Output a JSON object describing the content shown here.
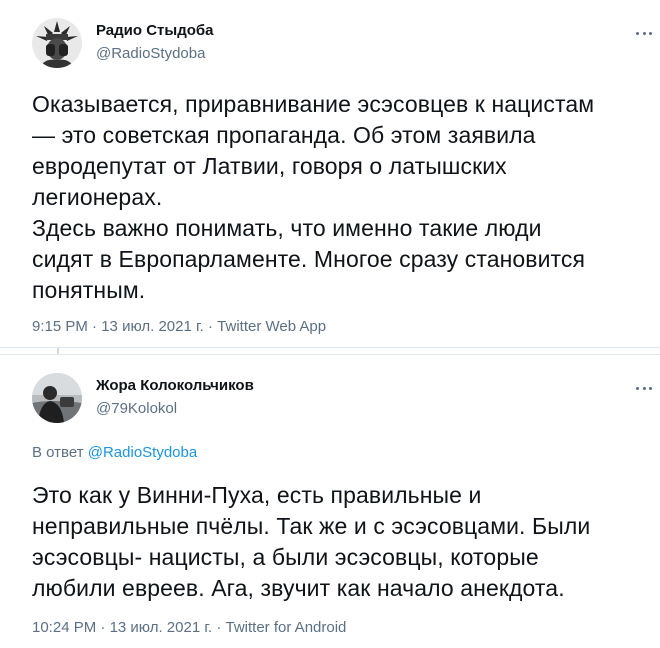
{
  "tweets": [
    {
      "author": {
        "name": "Радио Стыдоба",
        "handle": "@RadioStydoba",
        "avatar_icon": "statue-avatar"
      },
      "more_icon": "more-options-icon",
      "lines": [
        "Оказывается, приравнивание эсэсовцев к нацистам",
        "— это советская пропаганда. Об этом заявила",
        "евродепутат от Латвии, говоря о латышских",
        "легионерах.",
        "Здесь важно понимать, что именно такие люди",
        "сидят в Европарламенте. Многое сразу становится",
        "понятным."
      ],
      "time": "9:15 PM",
      "date": "13 июл. 2021 г.",
      "separator": "·",
      "source": "Twitter Web App"
    },
    {
      "author": {
        "name": "Жора Колокольчиков",
        "handle": "@79Kolokol",
        "avatar_icon": "person-avatar"
      },
      "more_icon": "more-options-icon",
      "reply_prefix": "В ответ",
      "reply_to": "@RadioStydoba",
      "lines": [
        "Это как у Винни-Пуха, есть правильные и",
        "неправильные пчёлы. Так же и с эсэсовцами. Были",
        "эсэсовцы- нацисты, а были эсэсовцы, которые",
        "любили евреев. Ага, звучит как начало анекдота."
      ],
      "time": "10:24 PM",
      "date": "13 июл. 2021 г.",
      "separator": "·",
      "source": "Twitter for Android"
    }
  ],
  "colors": {
    "primary_text": "#0f1419",
    "secondary_text": "#5b7083",
    "link": "#1b95e0",
    "divider": "#e1e8ed"
  }
}
